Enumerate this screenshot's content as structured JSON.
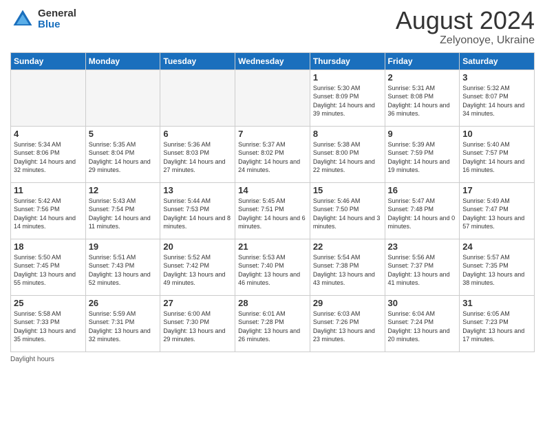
{
  "logo": {
    "general": "General",
    "blue": "Blue"
  },
  "title": {
    "month_year": "August 2024",
    "location": "Zelyonoye, Ukraine"
  },
  "days_of_week": [
    "Sunday",
    "Monday",
    "Tuesday",
    "Wednesday",
    "Thursday",
    "Friday",
    "Saturday"
  ],
  "footer": {
    "label": "Daylight hours"
  },
  "weeks": [
    [
      {
        "day": "",
        "sunrise": "",
        "sunset": "",
        "daylight": ""
      },
      {
        "day": "",
        "sunrise": "",
        "sunset": "",
        "daylight": ""
      },
      {
        "day": "",
        "sunrise": "",
        "sunset": "",
        "daylight": ""
      },
      {
        "day": "",
        "sunrise": "",
        "sunset": "",
        "daylight": ""
      },
      {
        "day": "1",
        "sunrise": "Sunrise: 5:30 AM",
        "sunset": "Sunset: 8:09 PM",
        "daylight": "Daylight: 14 hours and 39 minutes."
      },
      {
        "day": "2",
        "sunrise": "Sunrise: 5:31 AM",
        "sunset": "Sunset: 8:08 PM",
        "daylight": "Daylight: 14 hours and 36 minutes."
      },
      {
        "day": "3",
        "sunrise": "Sunrise: 5:32 AM",
        "sunset": "Sunset: 8:07 PM",
        "daylight": "Daylight: 14 hours and 34 minutes."
      }
    ],
    [
      {
        "day": "4",
        "sunrise": "Sunrise: 5:34 AM",
        "sunset": "Sunset: 8:06 PM",
        "daylight": "Daylight: 14 hours and 32 minutes."
      },
      {
        "day": "5",
        "sunrise": "Sunrise: 5:35 AM",
        "sunset": "Sunset: 8:04 PM",
        "daylight": "Daylight: 14 hours and 29 minutes."
      },
      {
        "day": "6",
        "sunrise": "Sunrise: 5:36 AM",
        "sunset": "Sunset: 8:03 PM",
        "daylight": "Daylight: 14 hours and 27 minutes."
      },
      {
        "day": "7",
        "sunrise": "Sunrise: 5:37 AM",
        "sunset": "Sunset: 8:02 PM",
        "daylight": "Daylight: 14 hours and 24 minutes."
      },
      {
        "day": "8",
        "sunrise": "Sunrise: 5:38 AM",
        "sunset": "Sunset: 8:00 PM",
        "daylight": "Daylight: 14 hours and 22 minutes."
      },
      {
        "day": "9",
        "sunrise": "Sunrise: 5:39 AM",
        "sunset": "Sunset: 7:59 PM",
        "daylight": "Daylight: 14 hours and 19 minutes."
      },
      {
        "day": "10",
        "sunrise": "Sunrise: 5:40 AM",
        "sunset": "Sunset: 7:57 PM",
        "daylight": "Daylight: 14 hours and 16 minutes."
      }
    ],
    [
      {
        "day": "11",
        "sunrise": "Sunrise: 5:42 AM",
        "sunset": "Sunset: 7:56 PM",
        "daylight": "Daylight: 14 hours and 14 minutes."
      },
      {
        "day": "12",
        "sunrise": "Sunrise: 5:43 AM",
        "sunset": "Sunset: 7:54 PM",
        "daylight": "Daylight: 14 hours and 11 minutes."
      },
      {
        "day": "13",
        "sunrise": "Sunrise: 5:44 AM",
        "sunset": "Sunset: 7:53 PM",
        "daylight": "Daylight: 14 hours and 8 minutes."
      },
      {
        "day": "14",
        "sunrise": "Sunrise: 5:45 AM",
        "sunset": "Sunset: 7:51 PM",
        "daylight": "Daylight: 14 hours and 6 minutes."
      },
      {
        "day": "15",
        "sunrise": "Sunrise: 5:46 AM",
        "sunset": "Sunset: 7:50 PM",
        "daylight": "Daylight: 14 hours and 3 minutes."
      },
      {
        "day": "16",
        "sunrise": "Sunrise: 5:47 AM",
        "sunset": "Sunset: 7:48 PM",
        "daylight": "Daylight: 14 hours and 0 minutes."
      },
      {
        "day": "17",
        "sunrise": "Sunrise: 5:49 AM",
        "sunset": "Sunset: 7:47 PM",
        "daylight": "Daylight: 13 hours and 57 minutes."
      }
    ],
    [
      {
        "day": "18",
        "sunrise": "Sunrise: 5:50 AM",
        "sunset": "Sunset: 7:45 PM",
        "daylight": "Daylight: 13 hours and 55 minutes."
      },
      {
        "day": "19",
        "sunrise": "Sunrise: 5:51 AM",
        "sunset": "Sunset: 7:43 PM",
        "daylight": "Daylight: 13 hours and 52 minutes."
      },
      {
        "day": "20",
        "sunrise": "Sunrise: 5:52 AM",
        "sunset": "Sunset: 7:42 PM",
        "daylight": "Daylight: 13 hours and 49 minutes."
      },
      {
        "day": "21",
        "sunrise": "Sunrise: 5:53 AM",
        "sunset": "Sunset: 7:40 PM",
        "daylight": "Daylight: 13 hours and 46 minutes."
      },
      {
        "day": "22",
        "sunrise": "Sunrise: 5:54 AM",
        "sunset": "Sunset: 7:38 PM",
        "daylight": "Daylight: 13 hours and 43 minutes."
      },
      {
        "day": "23",
        "sunrise": "Sunrise: 5:56 AM",
        "sunset": "Sunset: 7:37 PM",
        "daylight": "Daylight: 13 hours and 41 minutes."
      },
      {
        "day": "24",
        "sunrise": "Sunrise: 5:57 AM",
        "sunset": "Sunset: 7:35 PM",
        "daylight": "Daylight: 13 hours and 38 minutes."
      }
    ],
    [
      {
        "day": "25",
        "sunrise": "Sunrise: 5:58 AM",
        "sunset": "Sunset: 7:33 PM",
        "daylight": "Daylight: 13 hours and 35 minutes."
      },
      {
        "day": "26",
        "sunrise": "Sunrise: 5:59 AM",
        "sunset": "Sunset: 7:31 PM",
        "daylight": "Daylight: 13 hours and 32 minutes."
      },
      {
        "day": "27",
        "sunrise": "Sunrise: 6:00 AM",
        "sunset": "Sunset: 7:30 PM",
        "daylight": "Daylight: 13 hours and 29 minutes."
      },
      {
        "day": "28",
        "sunrise": "Sunrise: 6:01 AM",
        "sunset": "Sunset: 7:28 PM",
        "daylight": "Daylight: 13 hours and 26 minutes."
      },
      {
        "day": "29",
        "sunrise": "Sunrise: 6:03 AM",
        "sunset": "Sunset: 7:26 PM",
        "daylight": "Daylight: 13 hours and 23 minutes."
      },
      {
        "day": "30",
        "sunrise": "Sunrise: 6:04 AM",
        "sunset": "Sunset: 7:24 PM",
        "daylight": "Daylight: 13 hours and 20 minutes."
      },
      {
        "day": "31",
        "sunrise": "Sunrise: 6:05 AM",
        "sunset": "Sunset: 7:23 PM",
        "daylight": "Daylight: 13 hours and 17 minutes."
      }
    ]
  ]
}
